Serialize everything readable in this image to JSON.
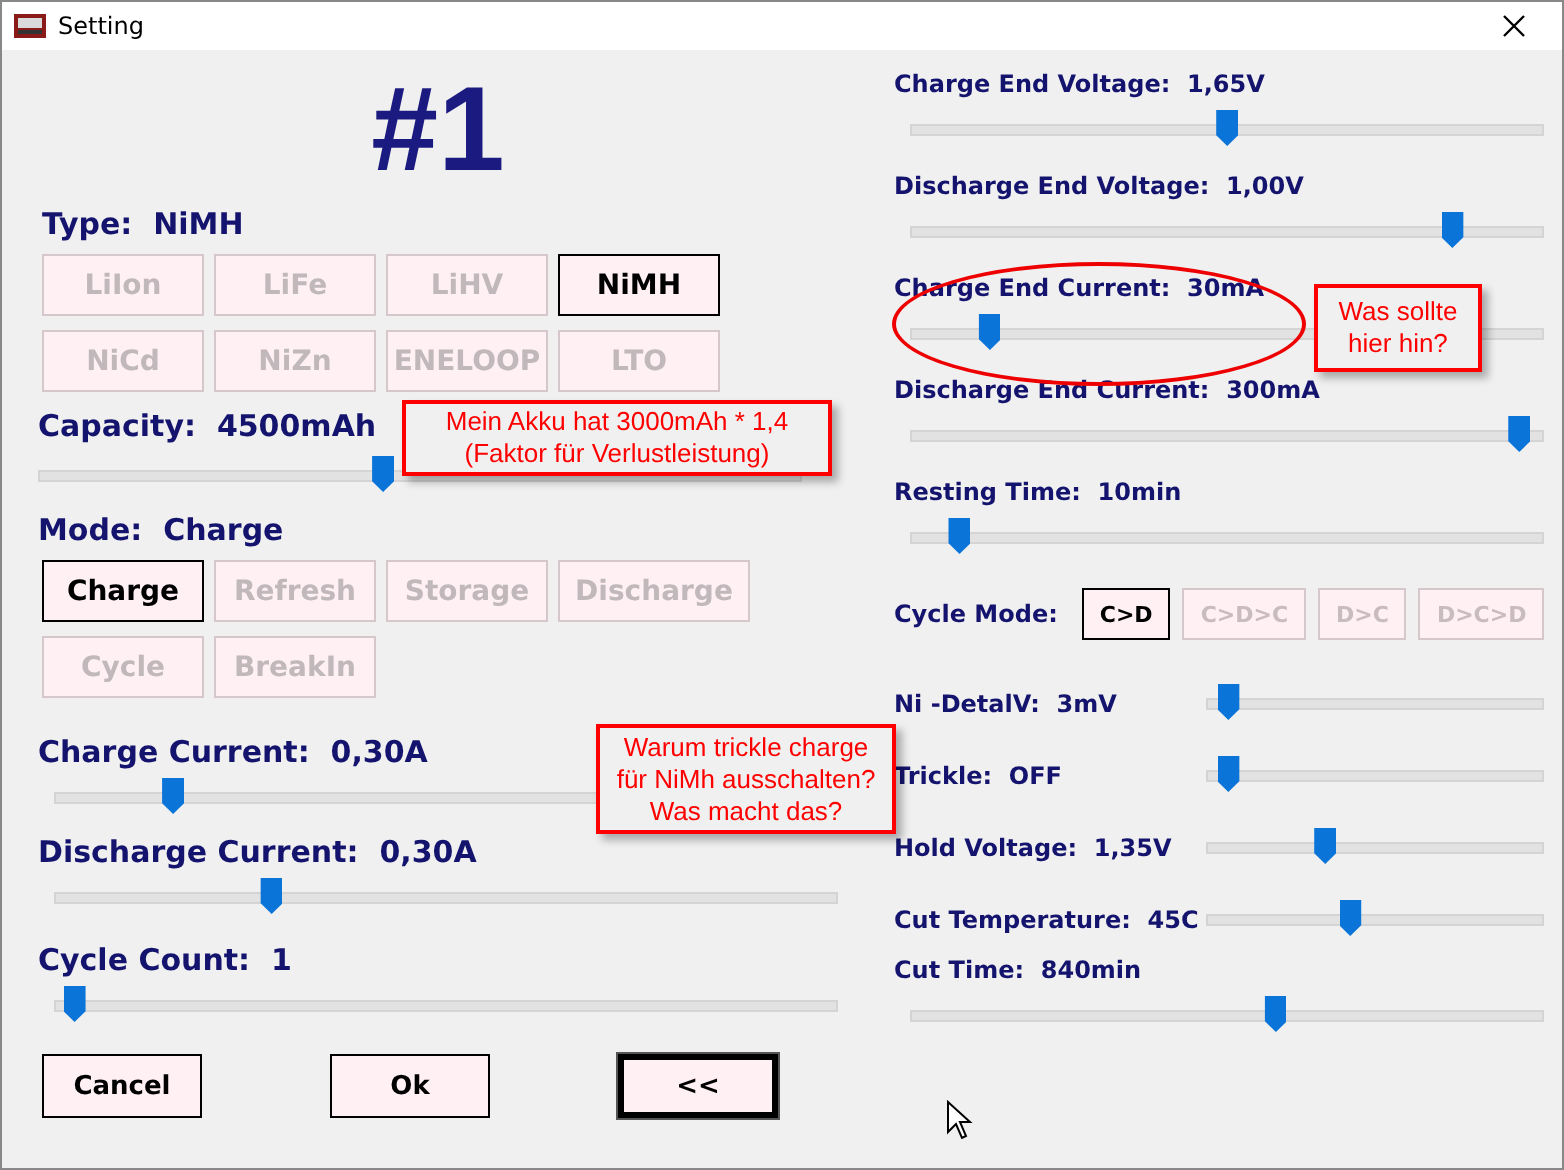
{
  "window": {
    "title": "Setting"
  },
  "left": {
    "heading": "#1",
    "type": {
      "label": "Type:",
      "value": "NiMH"
    },
    "type_buttons": [
      {
        "label": "LiIon",
        "selected": false
      },
      {
        "label": "LiFe",
        "selected": false
      },
      {
        "label": "LiHV",
        "selected": false
      },
      {
        "label": "NiMH",
        "selected": true
      },
      {
        "label": "NiCd",
        "selected": false
      },
      {
        "label": "NiZn",
        "selected": false
      },
      {
        "label": "ENELOOP",
        "selected": false
      },
      {
        "label": "LTO",
        "selected": false
      }
    ],
    "capacity": {
      "label": "Capacity:",
      "value": "4500mAh",
      "level": 0.45
    },
    "mode": {
      "label": "Mode:",
      "value": "Charge"
    },
    "mode_buttons": [
      {
        "label": "Charge",
        "selected": true
      },
      {
        "label": "Refresh",
        "selected": false
      },
      {
        "label": "Storage",
        "selected": false
      },
      {
        "label": "Discharge",
        "selected": false
      },
      {
        "label": "Cycle",
        "selected": false
      },
      {
        "label": "BreakIn",
        "selected": false
      }
    ],
    "sliders": [
      {
        "label": "Charge Current:",
        "value": "0,30A",
        "level": 0.14
      },
      {
        "label": "Discharge Current:",
        "value": "0,30A",
        "level": 0.27
      },
      {
        "label": "Cycle Count:",
        "value": "1",
        "level": 0.01
      }
    ],
    "buttons": [
      {
        "label": "Cancel",
        "focused": false
      },
      {
        "label": "Ok",
        "focused": false
      },
      {
        "label": "<<",
        "focused": true
      }
    ]
  },
  "right": {
    "settings": [
      {
        "kind": "stacked",
        "label": "Charge End Voltage:",
        "value": "1,65V",
        "level": 0.5
      },
      {
        "kind": "stacked",
        "label": "Discharge End Voltage:",
        "value": "1,00V",
        "level": 0.87
      },
      {
        "kind": "stacked",
        "label": "Charge End Current:",
        "value": "30mA",
        "level": 0.11
      },
      {
        "kind": "stacked",
        "label": "Discharge End Current:",
        "value": "300mA",
        "level": 0.98
      },
      {
        "kind": "stacked",
        "label": "Resting Time:",
        "value": "10min",
        "level": 0.06
      },
      {
        "kind": "buttons",
        "label": "Cycle Mode:",
        "options": [
          {
            "label": "C>D",
            "selected": true
          },
          {
            "label": "C>D>C",
            "selected": false
          },
          {
            "label": "D>C",
            "selected": false
          },
          {
            "label": "D>C>D",
            "selected": false
          }
        ]
      },
      {
        "kind": "inline",
        "label": "Ni -DetalV:",
        "value": "3mV",
        "level": 0.03
      },
      {
        "kind": "inline",
        "label": "Trickle:",
        "value": "OFF",
        "level": 0.03
      },
      {
        "kind": "inline",
        "label": "Hold Voltage:",
        "value": "1,35V",
        "level": 0.34
      },
      {
        "kind": "inline",
        "label": "Cut Temperature:",
        "value": "45C",
        "level": 0.42
      },
      {
        "kind": "stacked",
        "label": "Cut Time:",
        "value": "840min",
        "level": 0.58
      }
    ]
  },
  "annotations": [
    {
      "kind": "callout",
      "text": "Mein Akku hat 3000mAh * 1,4\n(Faktor für Verlustleistung)"
    },
    {
      "kind": "ellipse"
    },
    {
      "kind": "callout",
      "text": "Was sollte\nhier hin?"
    },
    {
      "kind": "callout",
      "text": "Warum trickle charge\nfür NiMh ausschalten?\nWas macht das?"
    }
  ]
}
